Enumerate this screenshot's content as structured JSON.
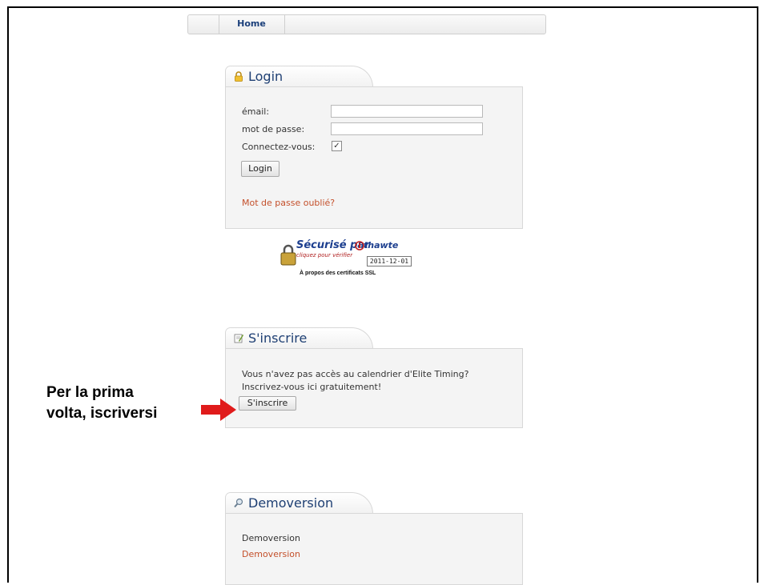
{
  "nav": {
    "home": "Home"
  },
  "login": {
    "title": "Login",
    "email_label": "émail:",
    "email_value": "",
    "password_label": "mot de passe:",
    "password_value": "",
    "remember_label": "Connectez-vous:",
    "remember_checked": "✓",
    "login_button": "Login",
    "forgot_link": "Mot de passe oublié?"
  },
  "ssl_seal": {
    "main_text": "Sécurisé par",
    "sub_text": "cliquez pour vérifier",
    "brand": "thawte",
    "date": "2011-12-01",
    "caption": "À propos des certificats SSL"
  },
  "register": {
    "title": "S'inscrire",
    "text_line1": "Vous n'avez pas accès au calendrier d'Elite Timing?",
    "text_line2": "Inscrivez-vous ici gratuitement!",
    "button": "S'inscrire"
  },
  "annotation": {
    "line1": "Per la prima",
    "line2": "volta, iscriversi",
    "arrow_color": "#e01b1b"
  },
  "demo": {
    "title": "Demoversion",
    "text": "Demoversion",
    "link": "Demoversion"
  },
  "colors": {
    "title_blue": "#1e3f73",
    "link_orange": "#c4502b"
  }
}
